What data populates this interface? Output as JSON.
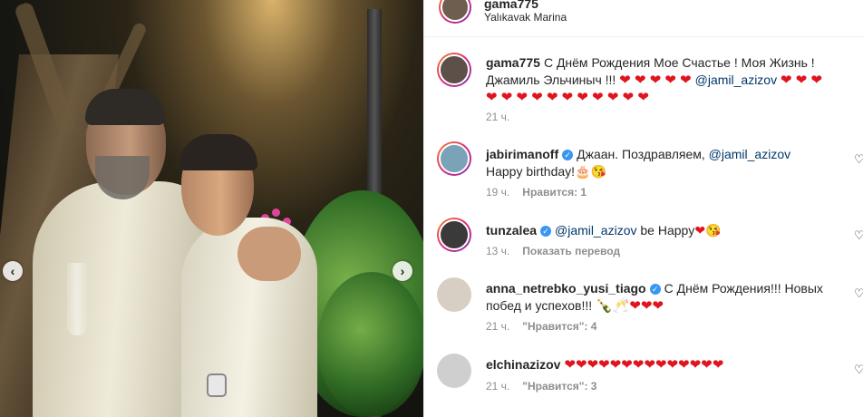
{
  "post": {
    "username": "gama775",
    "location": "Yalıkavak Marina"
  },
  "caption": {
    "username": "gama775",
    "text_1": "С Днём Рождения Мое Счастье ! Моя Жизнь ! Джамиль Эльчиныч !!! ",
    "hearts_1": "❤ ❤ ❤ ❤ ❤",
    "mention": "@jamil_azizov",
    "hearts_2": "❤ ❤ ❤",
    "hearts_3": "❤ ❤ ❤ ❤ ❤ ❤ ❤ ❤ ❤ ❤ ❤",
    "time": "21 ч."
  },
  "comments": [
    {
      "username": "jabirimanoff",
      "text_before": "Джаан. Поздравляем, ",
      "mention": "@jamil_azizov",
      "text_after": " Happy birthday!",
      "emoji": "🎂😘",
      "time": "19 ч.",
      "likes": "Нравится: 1"
    },
    {
      "username": "tunzalea",
      "mention": "@jamil_azizov",
      "text_after": " be Happy",
      "emoji": "❤😘",
      "time": "13 ч.",
      "action": "Показать перевод"
    },
    {
      "username": "anna_netrebko_yusi_tiago",
      "text": "С Днём Рождения!!! Новых побед и успехов!!! ",
      "emoji": "🍾🥂❤❤❤",
      "time": "21 ч.",
      "likes": "\"Нравится\": 4"
    },
    {
      "username": "elchinazizov",
      "hearts": "❤❤❤❤❤❤❤❤❤❤❤❤❤❤",
      "time": "21 ч.",
      "likes": "\"Нравится\": 3"
    }
  ],
  "icons": {
    "verified": "verified-badge-icon",
    "like": "heart-outline-icon",
    "carousel_prev": "chevron-left-icon",
    "carousel_next": "chevron-right-icon"
  },
  "colors": {
    "text": "#262626",
    "muted": "#8e8e8e",
    "mention": "#00376b",
    "heart": "#e0141e",
    "verified": "#3897f0"
  }
}
